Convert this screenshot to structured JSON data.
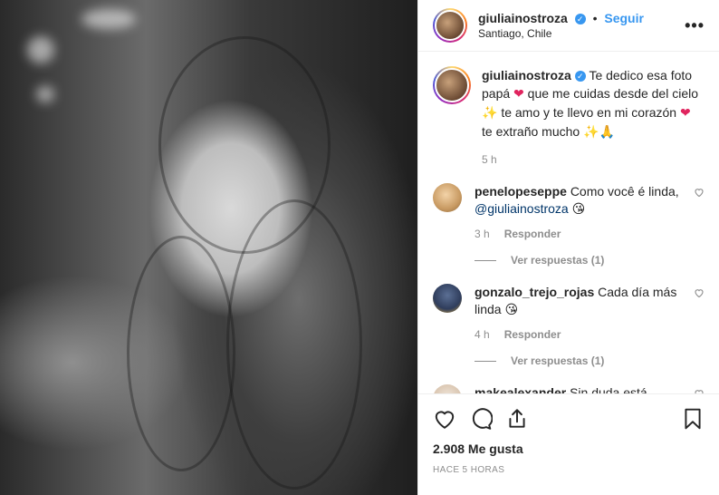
{
  "post": {
    "author": "giuliainostroza",
    "follow_label": "Seguir",
    "separator": "•",
    "location": "Santiago, Chile",
    "more_label": "•••",
    "caption": {
      "username": "giuliainostroza",
      "text_1": "Te dedico esa foto papá",
      "emoji_heart_1": "❤",
      "text_2": "que me cuidas desde del cielo",
      "emoji_angel_1": "✨",
      "text_3": "te amo y te llevo en mi corazón",
      "emoji_heart_2": "❤",
      "text_4": "te extraño mucho",
      "emoji_end": "✨🙏",
      "time": "5 h"
    },
    "comments": [
      {
        "username": "penelopeseppe",
        "text": "Como você é linda,",
        "mention": "@giuliainostroza",
        "emoji": "😘",
        "time": "3 h",
        "reply_label": "Responder",
        "view_replies": "Ver respuestas (1)"
      },
      {
        "username": "gonzalo_trejo_rojas",
        "text": "Cada día más linda",
        "emoji": "😘",
        "time": "4 h",
        "reply_label": "Responder",
        "view_replies": "Ver respuestas (1)"
      },
      {
        "username": "makealexander",
        "text": "Sin duda está"
      }
    ],
    "likes": "2.908 Me gusta",
    "posted_ago": "HACE 5 HORAS"
  },
  "icons": {
    "like": "heart-icon",
    "comment": "comment-icon",
    "share": "share-icon",
    "save": "bookmark-icon",
    "verified": "verified-badge-icon"
  },
  "colors": {
    "link": "#3897f0",
    "muted": "#8e8e8e",
    "text": "#262626",
    "mention": "#003569",
    "heart": "#e0245e"
  }
}
